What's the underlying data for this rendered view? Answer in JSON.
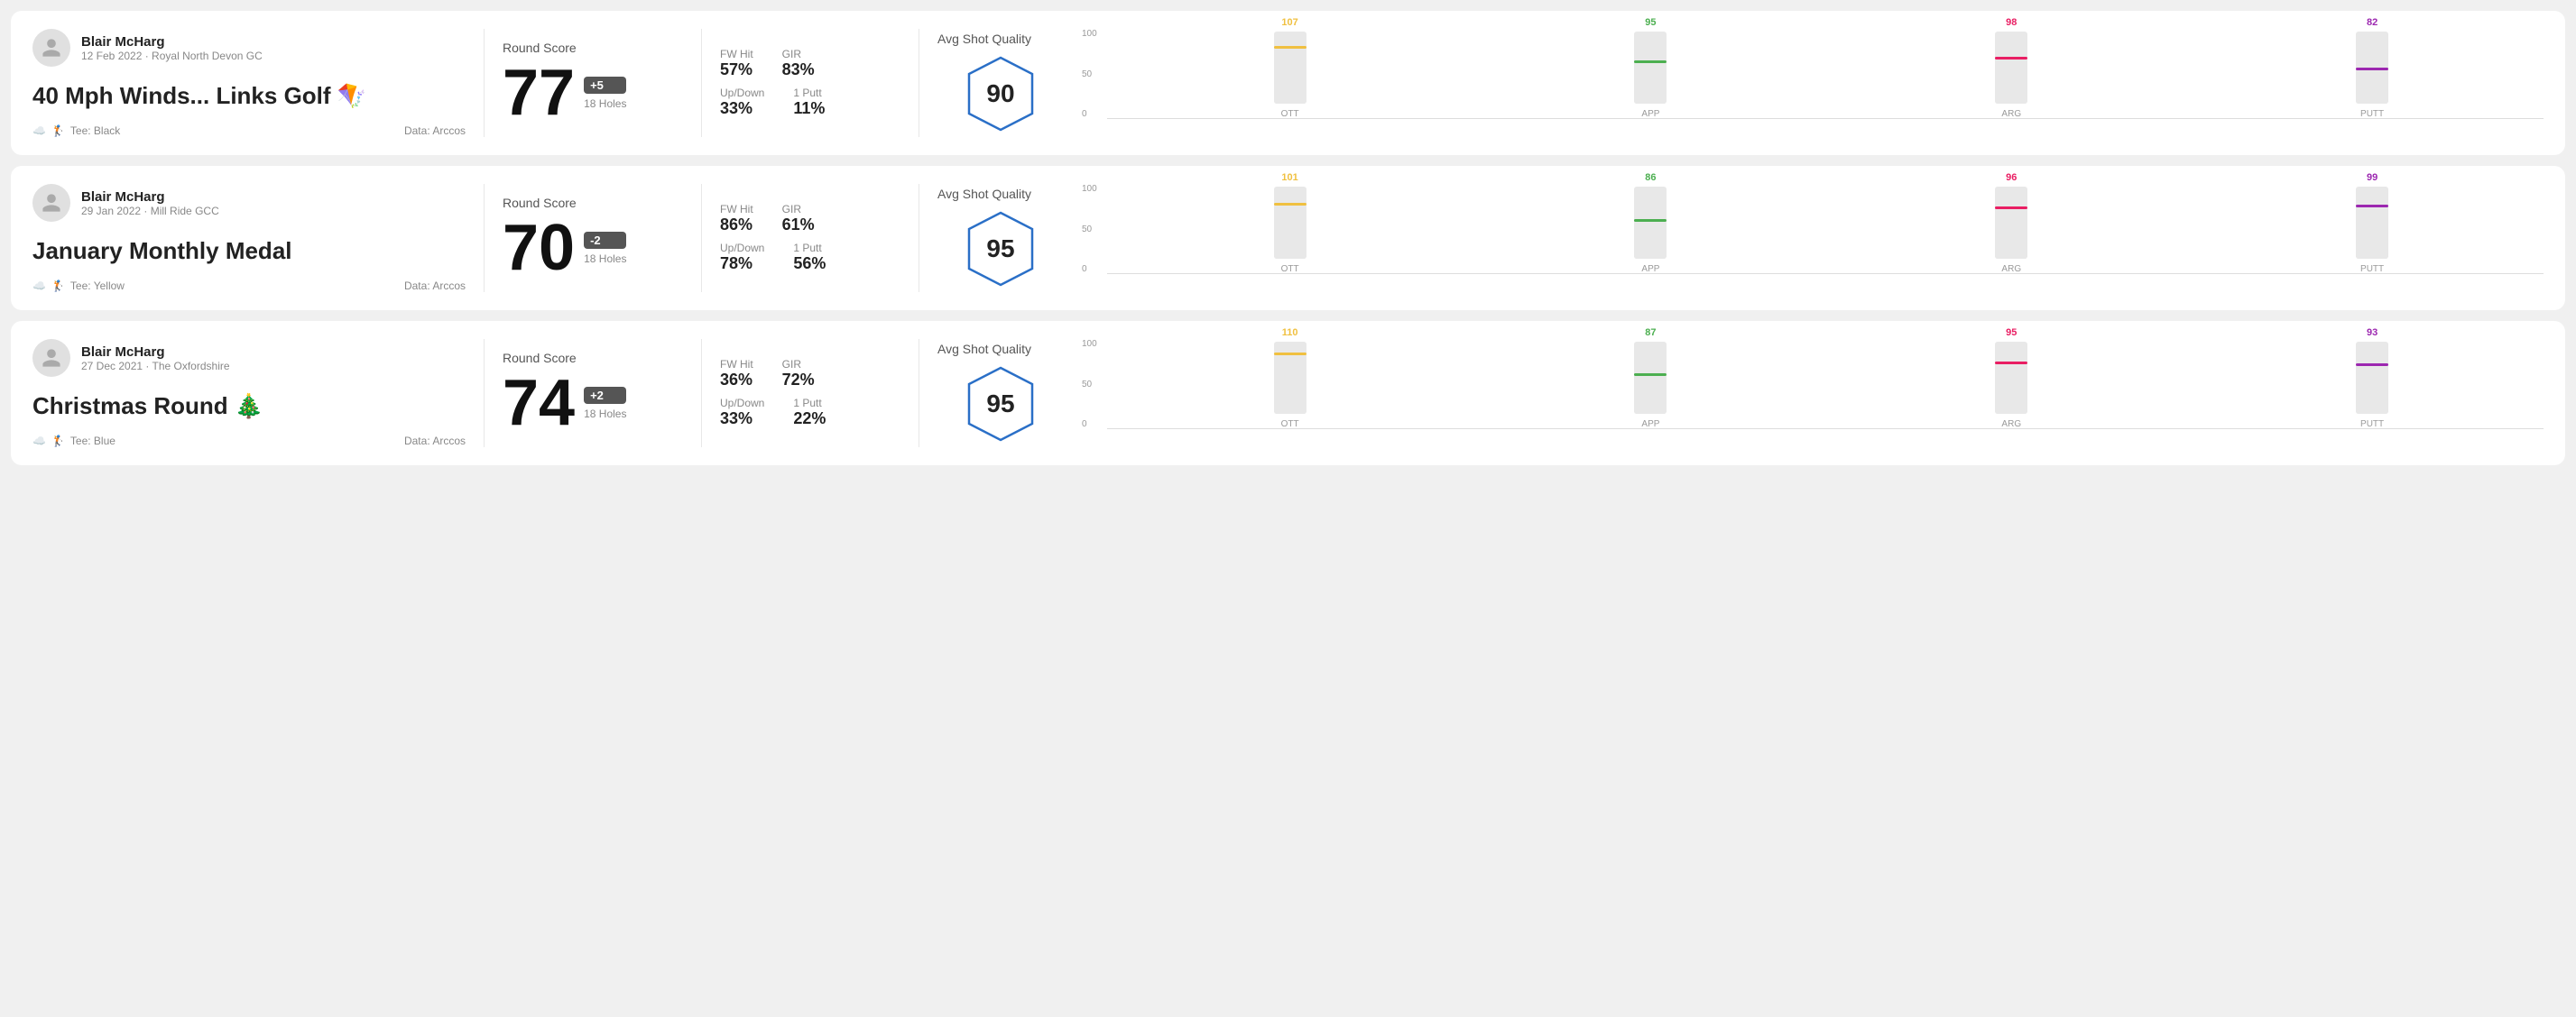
{
  "rounds": [
    {
      "id": "round1",
      "player_name": "Blair McHarg",
      "player_meta": "12 Feb 2022 · Royal North Devon GC",
      "round_title": "40 Mph Winds... Links Golf 🪁",
      "tee": "Tee: Black",
      "data_source": "Data: Arccos",
      "score": "77",
      "score_diff": "+5",
      "holes": "18 Holes",
      "fw_hit": "57%",
      "gir": "83%",
      "up_down": "33%",
      "one_putt": "11%",
      "avg_shot_quality": "90",
      "chart": {
        "bars": [
          {
            "category": "OTT",
            "value": 107,
            "color": "#f0c040",
            "pct": 80
          },
          {
            "category": "APP",
            "value": 95,
            "color": "#4caf50",
            "pct": 60
          },
          {
            "category": "ARG",
            "value": 98,
            "color": "#e91e63",
            "pct": 65
          },
          {
            "category": "PUTT",
            "value": 82,
            "color": "#9c27b0",
            "pct": 50
          }
        ]
      }
    },
    {
      "id": "round2",
      "player_name": "Blair McHarg",
      "player_meta": "29 Jan 2022 · Mill Ride GCC",
      "round_title": "January Monthly Medal",
      "tee": "Tee: Yellow",
      "data_source": "Data: Arccos",
      "score": "70",
      "score_diff": "-2",
      "holes": "18 Holes",
      "fw_hit": "86%",
      "gir": "61%",
      "up_down": "78%",
      "one_putt": "56%",
      "avg_shot_quality": "95",
      "chart": {
        "bars": [
          {
            "category": "OTT",
            "value": 101,
            "color": "#f0c040",
            "pct": 78
          },
          {
            "category": "APP",
            "value": 86,
            "color": "#4caf50",
            "pct": 55
          },
          {
            "category": "ARG",
            "value": 96,
            "color": "#e91e63",
            "pct": 72
          },
          {
            "category": "PUTT",
            "value": 99,
            "color": "#9c27b0",
            "pct": 75
          }
        ]
      }
    },
    {
      "id": "round3",
      "player_name": "Blair McHarg",
      "player_meta": "27 Dec 2021 · The Oxfordshire",
      "round_title": "Christmas Round 🎄",
      "tee": "Tee: Blue",
      "data_source": "Data: Arccos",
      "score": "74",
      "score_diff": "+2",
      "holes": "18 Holes",
      "fw_hit": "36%",
      "gir": "72%",
      "up_down": "33%",
      "one_putt": "22%",
      "avg_shot_quality": "95",
      "chart": {
        "bars": [
          {
            "category": "OTT",
            "value": 110,
            "color": "#f0c040",
            "pct": 85
          },
          {
            "category": "APP",
            "value": 87,
            "color": "#4caf50",
            "pct": 56
          },
          {
            "category": "ARG",
            "value": 95,
            "color": "#e91e63",
            "pct": 72
          },
          {
            "category": "PUTT",
            "value": 93,
            "color": "#9c27b0",
            "pct": 70
          }
        ]
      }
    }
  ],
  "labels": {
    "round_score": "Round Score",
    "fw_hit": "FW Hit",
    "gir": "GIR",
    "up_down": "Up/Down",
    "one_putt": "1 Putt",
    "avg_shot_quality": "Avg Shot Quality",
    "y_100": "100",
    "y_50": "50",
    "y_0": "0"
  }
}
